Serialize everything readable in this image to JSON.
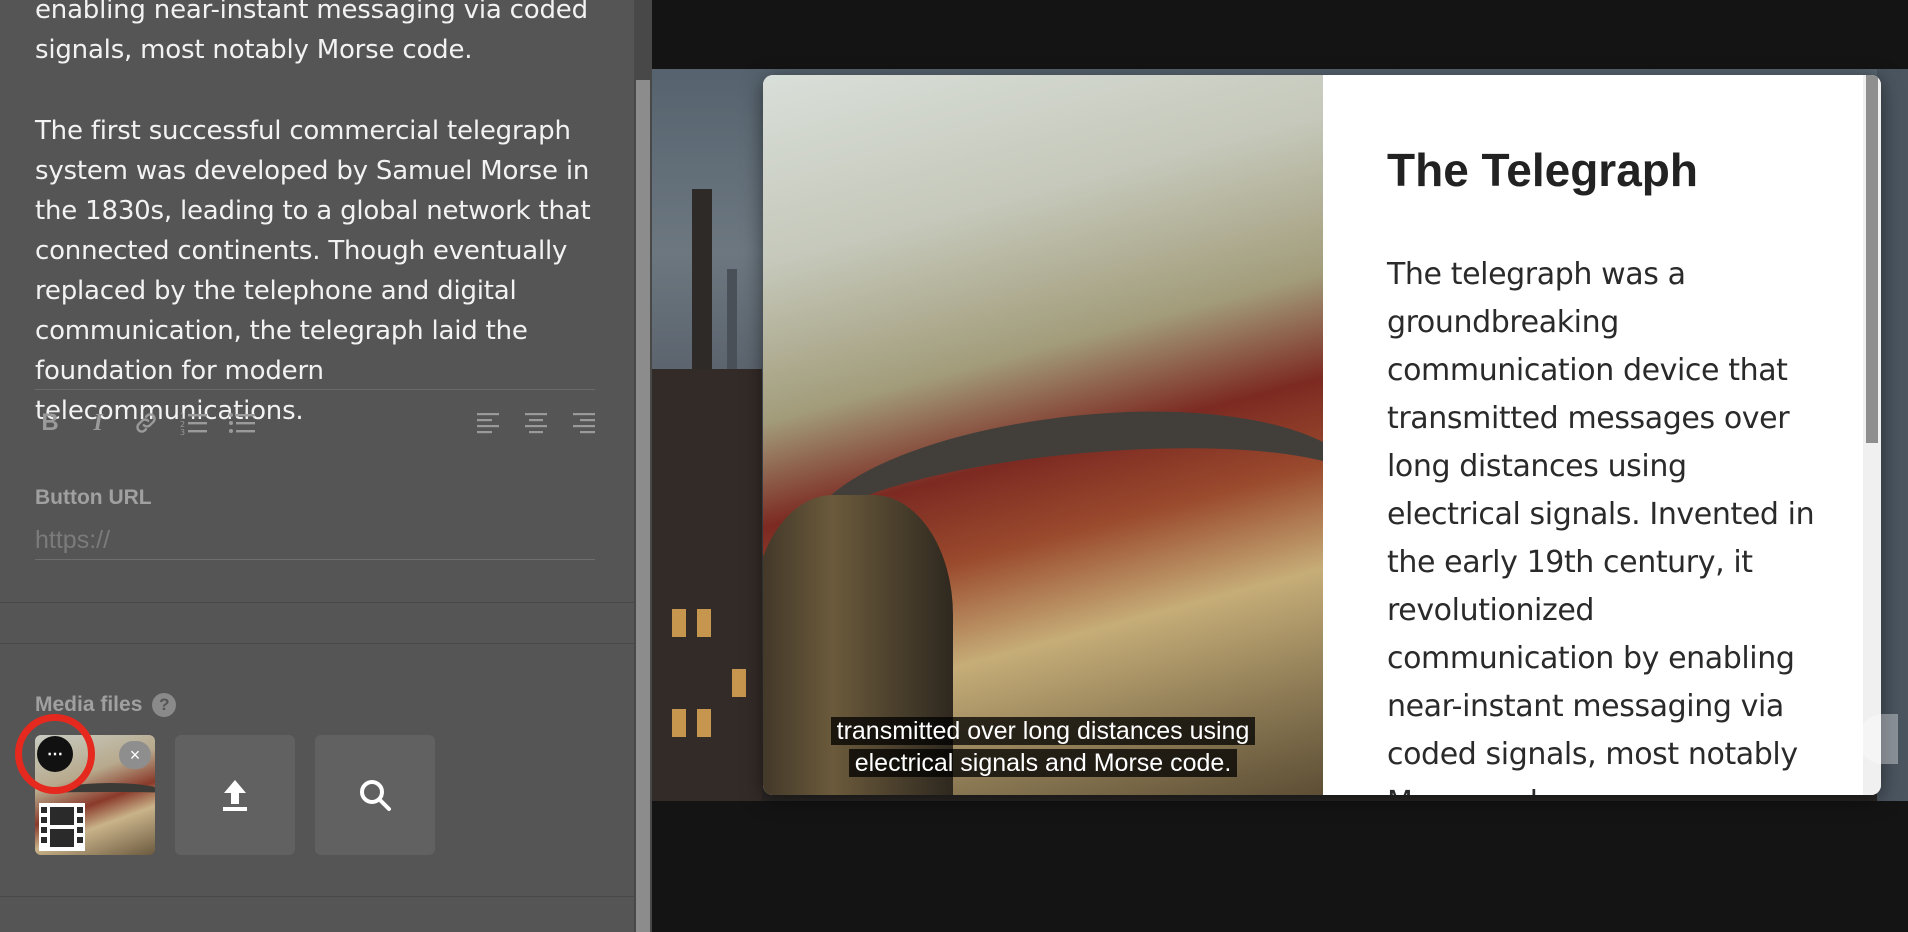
{
  "editor": {
    "paragraph1": "enabling near-instant messaging via coded signals, most notably Morse code.",
    "paragraph2": "The first successful commercial telegraph system was developed by Samuel Morse in the 1830s, leading to a global network that connected continents. Though eventually replaced by the telephone and digital communication, the telegraph laid the foundation for modern telecommunications.",
    "toolbar": {
      "bold": "B",
      "italic": "I"
    },
    "button_url": {
      "label": "Button URL",
      "placeholder": "https://"
    },
    "media": {
      "label": "Media files",
      "help": "?",
      "more": "⋯",
      "close": "×"
    }
  },
  "preview": {
    "title": "The Telegraph",
    "body": "The telegraph was a groundbreaking communication device that transmitted messages over long distances using electrical signals. Invented in the early 19th century, it revolutionized communication by enabling near-instant messaging via coded signals, most notably Morse code.",
    "caption_line1": "transmitted over long distances using",
    "caption_line2": "electrical signals and Morse code."
  },
  "colors": {
    "editor_bg": "#555555",
    "highlight_ring": "#e5291f",
    "page_bg": "#141414"
  },
  "icons": [
    "bold-icon",
    "italic-icon",
    "link-icon",
    "ordered-list-icon",
    "bullet-list-icon",
    "align-left-icon",
    "align-center-icon",
    "align-right-icon",
    "help-icon",
    "more-icon",
    "close-icon",
    "film-icon",
    "upload-icon",
    "search-icon"
  ]
}
